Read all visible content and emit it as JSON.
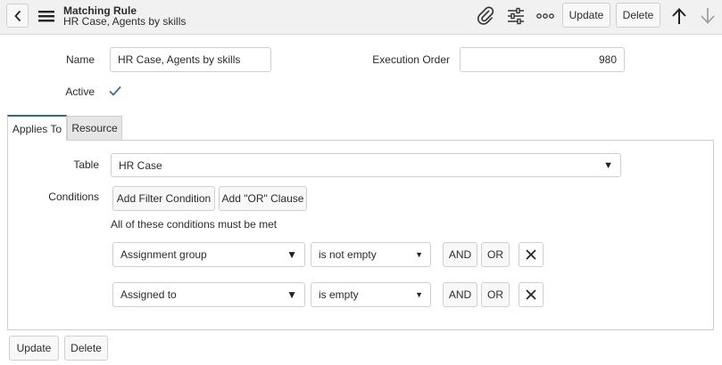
{
  "header": {
    "record_type": "Matching Rule",
    "record_name": "HR Case, Agents by skills",
    "update_label": "Update",
    "delete_label": "Delete"
  },
  "form": {
    "name_label": "Name",
    "name_value": "HR Case, Agents by skills",
    "execution_order_label": "Execution Order",
    "execution_order_value": "980",
    "active_label": "Active",
    "active_checked": true
  },
  "tabs": [
    {
      "label": "Applies To",
      "active": true
    },
    {
      "label": "Resource",
      "active": false
    }
  ],
  "applies_to": {
    "table_label": "Table",
    "table_value": "HR Case",
    "conditions_label": "Conditions",
    "add_filter_label": "Add Filter Condition",
    "add_or_label": "Add \"OR\" Clause",
    "conditions_hint": "All of these conditions must be met",
    "conditions": [
      {
        "field": "Assignment group",
        "operator": "is not empty",
        "and_label": "AND",
        "or_label": "OR"
      },
      {
        "field": "Assigned to",
        "operator": "is empty",
        "and_label": "AND",
        "or_label": "OR"
      }
    ]
  },
  "footer": {
    "update_label": "Update",
    "delete_label": "Delete"
  }
}
